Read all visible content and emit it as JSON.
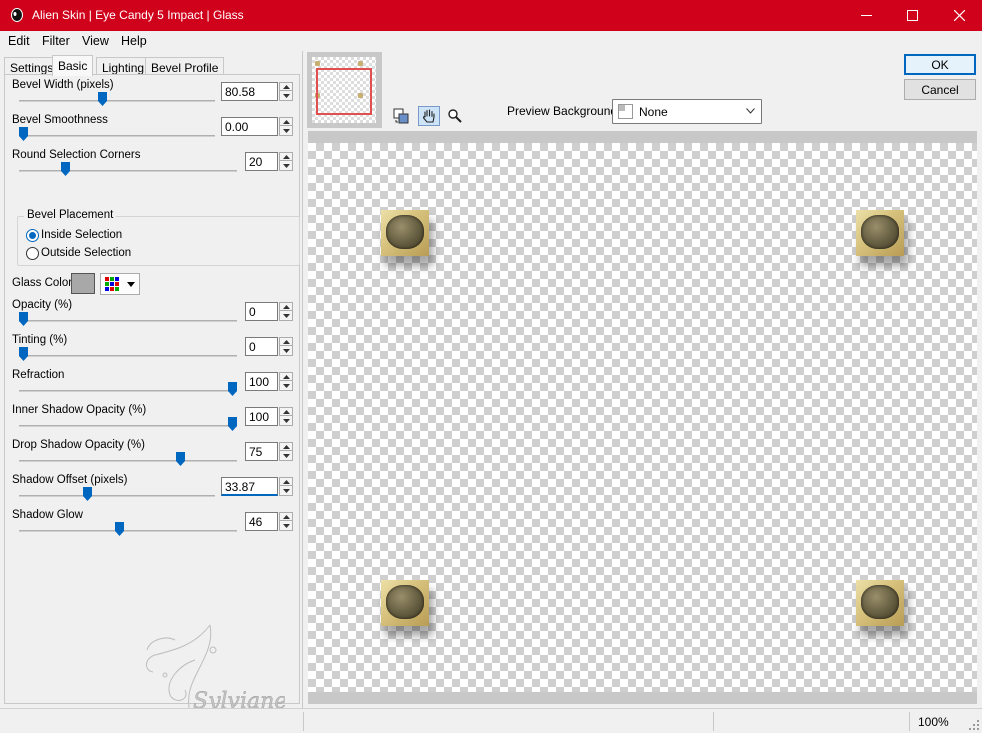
{
  "window": {
    "title": "Alien Skin | Eye Candy 5 Impact | Glass"
  },
  "menu": {
    "items": [
      "Edit",
      "Filter",
      "View",
      "Help"
    ]
  },
  "tabs": [
    "Settings",
    "Basic",
    "Lighting",
    "Bevel Profile"
  ],
  "active_tab": "Basic",
  "controls": {
    "bevel_width": {
      "label": "Bevel Width (pixels)",
      "value": "80.58",
      "level_pct": 42
    },
    "bevel_smoothness": {
      "label": "Bevel Smoothness",
      "value": "0.00",
      "level_pct": 0
    },
    "round_corners": {
      "label": "Round Selection Corners",
      "value": "20",
      "level_pct": 20
    },
    "bevel_placement": {
      "legend": "Bevel Placement",
      "inside": "Inside Selection",
      "outside": "Outside Selection",
      "selected": "inside"
    },
    "glass_color": {
      "label": "Glass Color",
      "color": "#a8a8a8"
    },
    "opacity": {
      "label": "Opacity (%)",
      "value": "0",
      "level_pct": 0
    },
    "tinting": {
      "label": "Tinting (%)",
      "value": "0",
      "level_pct": 0
    },
    "refraction": {
      "label": "Refraction",
      "value": "100",
      "level_pct": 100
    },
    "inner_shadow_opacity": {
      "label": "Inner Shadow Opacity (%)",
      "value": "100",
      "level_pct": 100
    },
    "drop_shadow_opacity": {
      "label": "Drop Shadow Opacity (%)",
      "value": "75",
      "level_pct": 75
    },
    "shadow_offset": {
      "label": "Shadow Offset (pixels)",
      "value": "33.87",
      "level_pct": 34
    },
    "shadow_glow": {
      "label": "Shadow Glow",
      "value": "46",
      "level_pct": 46
    }
  },
  "watermark_text": "Sylviane",
  "preview_bg": {
    "label": "Preview Background:",
    "value": "None"
  },
  "buttons": {
    "ok": "OK",
    "cancel": "Cancel"
  },
  "status": {
    "zoom": "100%"
  },
  "colors": {
    "titlebar": "#d0021b",
    "accent": "#0067c0"
  }
}
